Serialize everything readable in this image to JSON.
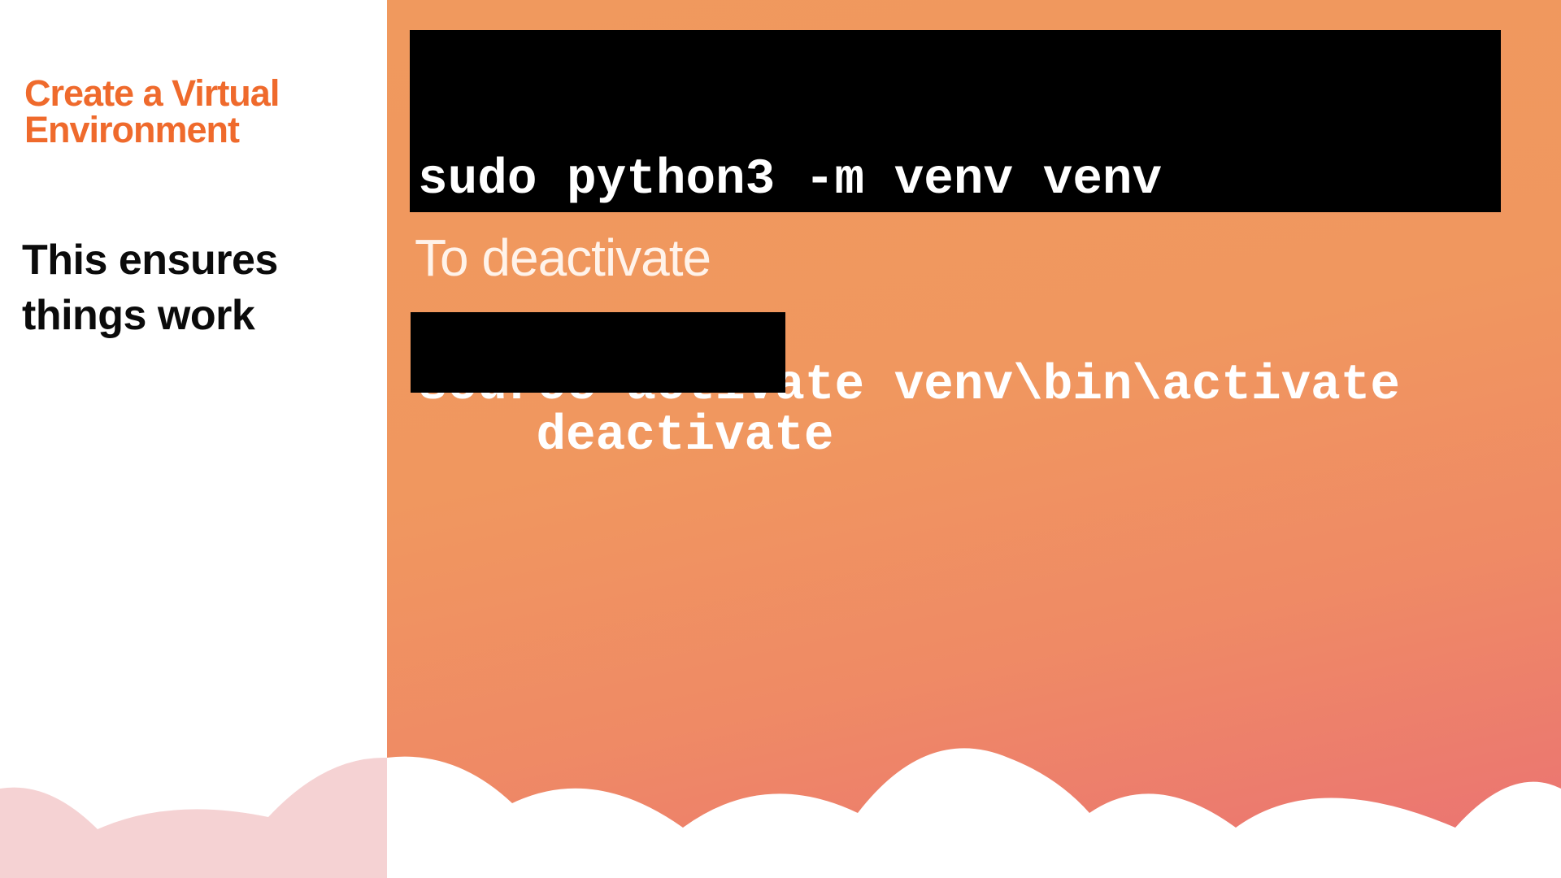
{
  "slide": {
    "title": "Create a Virtual Environment",
    "subtitle": "This ensures things work",
    "code_block_main": {
      "lines": [
        "sudo python3 -m venv venv",
        "source activate venv\\bin\\activate"
      ]
    },
    "deactivate_label": "To deactivate",
    "code_block_deactivate": {
      "line": "deactivate"
    }
  },
  "colors": {
    "title": "#ef6a2c",
    "subtitle": "#0b0b0b",
    "background_gradient_top": "#f0995e",
    "background_gradient_bottom": "#ea7174",
    "code_background": "#000000",
    "code_text": "#ffffff",
    "cloud_white": "#ffffff",
    "cloud_pink": "#f5d2d3"
  }
}
